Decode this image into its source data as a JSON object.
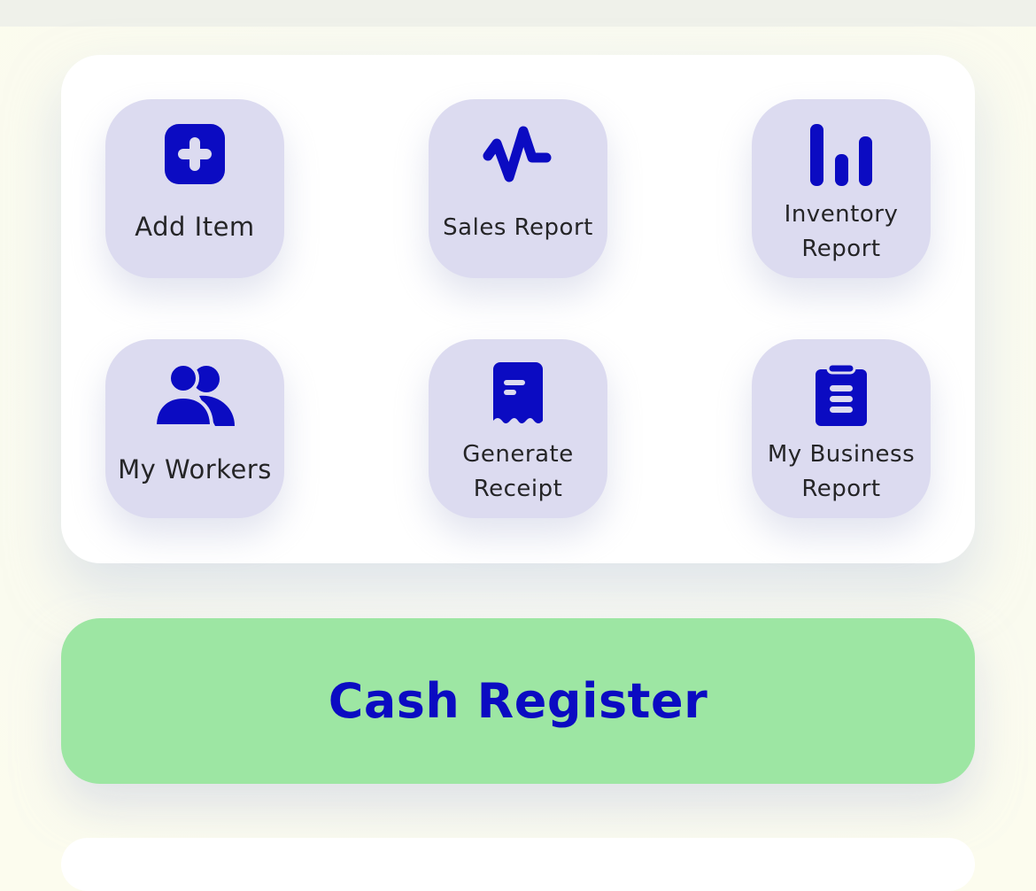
{
  "grid": {
    "tiles": [
      {
        "label": "Add Item",
        "icon": "plus-square-icon"
      },
      {
        "label": "Sales Report",
        "icon": "activity-icon"
      },
      {
        "label": "Inventory Report",
        "icon": "bar-chart-icon"
      },
      {
        "label": "My Workers",
        "icon": "users-icon"
      },
      {
        "label": "Generate Receipt",
        "icon": "receipt-icon"
      },
      {
        "label": "My Business Report",
        "icon": "clipboard-icon"
      }
    ]
  },
  "cash_register": {
    "label": "Cash Register"
  },
  "colors": {
    "accent": "#0b0bc2",
    "tile_bg": "#dcdbf0",
    "cash_button_bg": "#9de6a3",
    "page_bg": "#fcfcee"
  }
}
